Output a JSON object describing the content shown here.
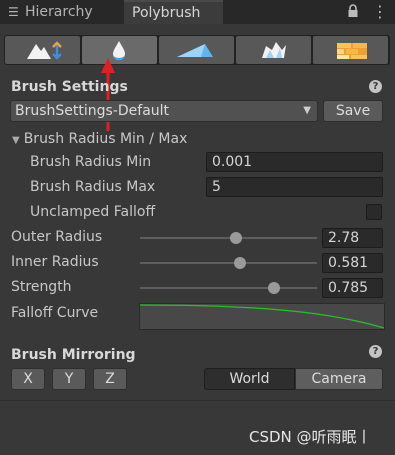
{
  "tabs": {
    "hierarchy_label": "Hierarchy",
    "polybrush_label": "Polybrush"
  },
  "tool_modes": [
    "sculpt-tool",
    "smooth-tool",
    "paint-vertex-color-tool",
    "prefab-scatter-tool",
    "paint-texture-tool"
  ],
  "brush_settings": {
    "header": "Brush Settings",
    "preset_value": "BrushSettings-Default",
    "save_label": "Save",
    "foldout_label": "Brush Radius Min / Max",
    "radius_min_label": "Brush Radius Min",
    "radius_min_value": "0.001",
    "radius_max_label": "Brush Radius Max",
    "radius_max_value": "5",
    "unclamped_label": "Unclamped Falloff",
    "unclamped_checked": false,
    "outer_radius_label": "Outer Radius",
    "outer_radius_value": "2.78",
    "inner_radius_label": "Inner Radius",
    "inner_radius_value": "0.581",
    "strength_label": "Strength",
    "strength_value": "0.785",
    "falloff_label": "Falloff Curve"
  },
  "brush_mirroring": {
    "header": "Brush Mirroring",
    "x_label": "X",
    "y_label": "Y",
    "z_label": "Z",
    "world_label": "World",
    "camera_label": "Camera",
    "active_space": "Camera"
  },
  "watermark": "CSDN @听雨眠丨",
  "colors": {
    "panel_bg": "#383838",
    "annotation_arrow": "#e02020",
    "curve_line": "#22c422",
    "water_drop": "#2aa4f0"
  }
}
